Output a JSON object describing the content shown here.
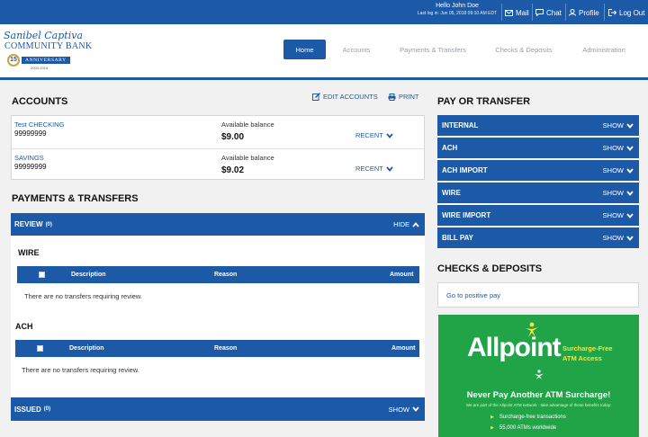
{
  "topbar": {
    "greeting": "Hello John Doe",
    "last_login": "Last log in: Jun 05, 2018 09:10 AM EDT",
    "links": {
      "mail": "Mail",
      "chat": "Chat",
      "profile": "Profile",
      "logout": "Log Out"
    }
  },
  "logo": {
    "line1": "Sanibel Captiva",
    "line2": "COMMUNITY BANK",
    "number": "15",
    "anniversary": "ANNIVERSARY",
    "years": "2003-2018"
  },
  "nav": [
    "Home",
    "Accounts",
    "Payments & Transfers",
    "Checks & Deposits",
    "Administration"
  ],
  "accounts": {
    "title": "ACCOUNTS",
    "edit_label": "EDIT ACCOUNTS",
    "print_label": "PRINT",
    "items": [
      {
        "name": "Test CHECKING",
        "number": "99999999",
        "balance_label": "Available balance",
        "balance": "$9.00",
        "recent": "RECENT"
      },
      {
        "name": "SAVINGS",
        "number": "99999999",
        "balance_label": "Available balance",
        "balance": "$9.02",
        "recent": "RECENT"
      }
    ]
  },
  "payments": {
    "title": "PAYMENTS & TRANSFERS",
    "review": {
      "label": "REVIEW",
      "count": "(0)",
      "toggle": "HIDE"
    },
    "wire": {
      "title": "WIRE",
      "columns": [
        "Description",
        "Reason",
        "Amount"
      ],
      "empty": "There are no transfers requiring review."
    },
    "ach": {
      "title": "ACH",
      "columns": [
        "Description",
        "Reason",
        "Amount"
      ],
      "empty": "There are no transfers requiring review."
    },
    "issued": {
      "label": "ISSUED",
      "count": "(0)",
      "toggle": "SHOW"
    }
  },
  "pay_or_transfer": {
    "title": "PAY OR TRANSFER",
    "items": [
      {
        "label": "INTERNAL",
        "toggle": "SHOW"
      },
      {
        "label": "ACH",
        "toggle": "SHOW"
      },
      {
        "label": "ACH IMPORT",
        "toggle": "SHOW"
      },
      {
        "label": "WIRE",
        "toggle": "SHOW"
      },
      {
        "label": "WIRE IMPORT",
        "toggle": "SHOW"
      },
      {
        "label": "BILL PAY",
        "toggle": "SHOW"
      }
    ]
  },
  "checks": {
    "title": "CHECKS & DEPOSITS",
    "link": "Go to positive pay"
  },
  "ad": {
    "brand": "Allpoint",
    "tag_line1": "Surcharge-Free",
    "tag_line2": "ATM Access",
    "headline": "Never Pay Another ATM Surcharge!",
    "subtext": "We are part of the Allpoint ATM network - take advantage of these benefits today:",
    "bullets": [
      "Surcharge-free transactions",
      "55,000 ATMs worldwide"
    ]
  },
  "colors": {
    "primary": "#1c5aa8",
    "ad_green": "#21a347",
    "ad_yellow": "#f7e43c"
  }
}
